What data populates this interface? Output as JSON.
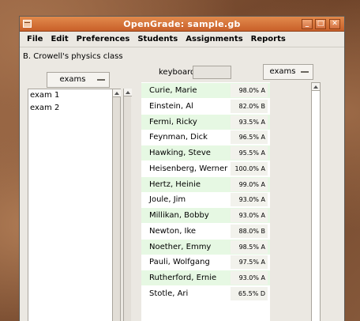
{
  "window": {
    "title": "OpenGrade: sample.gb",
    "controls": [
      "_",
      "□",
      "✕"
    ]
  },
  "menubar": {
    "items": [
      "File",
      "Edit",
      "Preferences",
      "Students",
      "Assignments",
      "Reports"
    ]
  },
  "class_name": "B. Crowell's physics class",
  "left_dropdown": {
    "selected": "exams"
  },
  "left_list": {
    "items": [
      "exam 1",
      "exam 2"
    ]
  },
  "keyboard": {
    "label": "keyboard",
    "value": ""
  },
  "right_dropdown": {
    "selected": "exams"
  },
  "students": [
    {
      "name": "Curie, Marie",
      "score": "98.0% A"
    },
    {
      "name": "Einstein, Al",
      "score": "82.0% B"
    },
    {
      "name": "Fermi, Ricky",
      "score": "93.5% A"
    },
    {
      "name": "Feynman, Dick",
      "score": "96.5% A"
    },
    {
      "name": "Hawking, Steve",
      "score": "95.5% A"
    },
    {
      "name": "Heisenberg, Werner",
      "score": "100.0% A"
    },
    {
      "name": "Hertz, Heinie",
      "score": "99.0% A"
    },
    {
      "name": "Joule, Jim",
      "score": "93.0% A"
    },
    {
      "name": "Millikan, Bobby",
      "score": "93.0% A"
    },
    {
      "name": "Newton, Ike",
      "score": "88.0% B"
    },
    {
      "name": "Noether, Emmy",
      "score": "98.5% A"
    },
    {
      "name": "Pauli, Wolfgang",
      "score": "97.5% A"
    },
    {
      "name": "Rutherford, Ernie",
      "score": "93.0% A"
    },
    {
      "name": "Stotle, Ari",
      "score": "65.5% D"
    }
  ],
  "colors": {
    "titlebar": "#d2703a",
    "row_green": "#e6f8e3",
    "window_bg": "#ebe8e2"
  }
}
